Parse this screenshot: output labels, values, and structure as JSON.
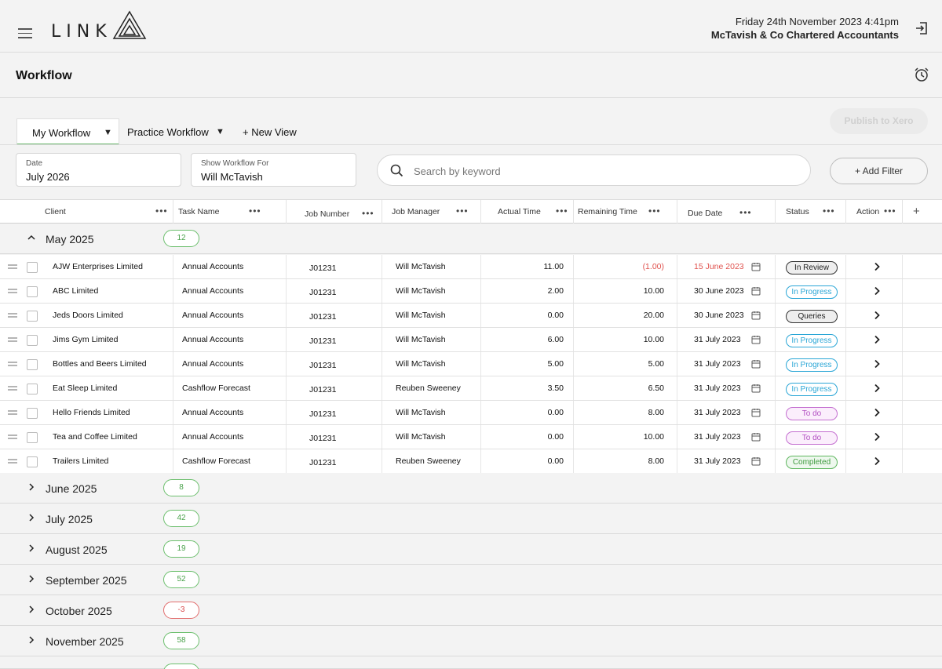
{
  "header": {
    "logo_text": "LINK",
    "date_time": "Friday 24th November 2023  4:41pm",
    "company": "McTavish & Co Chartered Accountants"
  },
  "page": {
    "title": "Workflow"
  },
  "view_tabs": {
    "my_workflow": "My Workflow",
    "practice_workflow": "Practice Workflow",
    "new_view": "+ New View",
    "caret": "▼"
  },
  "publish_label": "Publish to Xero",
  "filters": {
    "date_label": "Date",
    "date_value": "July 2026",
    "show_label": "Show Workflow For",
    "show_value": "Will McTavish",
    "search_placeholder": "Search by keyword",
    "add_filter_label": "+ Add Filter"
  },
  "columns": {
    "client": "Client",
    "task": "Task Name",
    "job_number": "Job Number",
    "manager": "Job Manager",
    "actual": "Actual Time",
    "remaining": "Remaining Time",
    "due": "Due Date",
    "status": "Status",
    "action": "Action",
    "menu_dots": "•••",
    "add_column": "+"
  },
  "expanded_group": {
    "label": "May 2025",
    "count": "12"
  },
  "rows": [
    {
      "client": "AJW Enterprises Limited",
      "task": "Annual Accounts",
      "job": "J01231",
      "manager": "Will McTavish",
      "actual": "11.00",
      "remaining": "(1.00)",
      "due": "15 June 2023",
      "status": "In Review"
    },
    {
      "client": "ABC Limited",
      "task": "Annual Accounts",
      "job": "J01231",
      "manager": "Will McTavish",
      "actual": "2.00",
      "remaining": "10.00",
      "due": "30 June 2023",
      "status": "In Progress"
    },
    {
      "client": "Jeds Doors Limited",
      "task": "Annual Accounts",
      "job": "J01231",
      "manager": "Will McTavish",
      "actual": "0.00",
      "remaining": "20.00",
      "due": "30 June 2023",
      "status": "Queries"
    },
    {
      "client": "Jims Gym Limited",
      "task": "Annual Accounts",
      "job": "J01231",
      "manager": "Will McTavish",
      "actual": "6.00",
      "remaining": "10.00",
      "due": "31 July 2023",
      "status": "In Progress"
    },
    {
      "client": "Bottles and Beers Limited",
      "task": "Annual Accounts",
      "job": "J01231",
      "manager": "Will McTavish",
      "actual": "5.00",
      "remaining": "5.00",
      "due": "31 July 2023",
      "status": "In Progress"
    },
    {
      "client": "Eat Sleep Limited",
      "task": "Cashflow Forecast",
      "job": "J01231",
      "manager": "Reuben Sweeney",
      "actual": "3.50",
      "remaining": "6.50",
      "due": "31 July 2023",
      "status": "In Progress"
    },
    {
      "client": "Hello Friends Limited",
      "task": "Annual Accounts",
      "job": "J01231",
      "manager": "Will McTavish",
      "actual": "0.00",
      "remaining": "8.00",
      "due": "31 July 2023",
      "status": "To do"
    },
    {
      "client": "Tea and Coffee Limited",
      "task": "Annual Accounts",
      "job": "J01231",
      "manager": "Will McTavish",
      "actual": "0.00",
      "remaining": "10.00",
      "due": "31 July 2023",
      "status": "To do"
    },
    {
      "client": "Trailers Limited",
      "task": "Cashflow Forecast",
      "job": "J01231",
      "manager": "Reuben Sweeney",
      "actual": "0.00",
      "remaining": "8.00",
      "due": "31 July 2023",
      "status": "Completed"
    }
  ],
  "collapsed_groups": [
    {
      "label": "June 2025",
      "count": "8"
    },
    {
      "label": "July 2025",
      "count": "42"
    },
    {
      "label": "August 2025",
      "count": "19"
    },
    {
      "label": "September 2025",
      "count": "52"
    },
    {
      "label": "October 2025",
      "count": "-3"
    },
    {
      "label": "November 2025",
      "count": "58"
    }
  ],
  "status_colors": {
    "In Review": {
      "border": "#333333",
      "bg": "#eeeeee",
      "text": "#222222"
    },
    "Queries": {
      "border": "#333333",
      "bg": "#eeeeee",
      "text": "#222222"
    },
    "In Progress": {
      "border": "#2aa6d6",
      "bg": "#ffffff",
      "text": "#2aa6d6"
    },
    "To do": {
      "border": "#c46fd0",
      "bg": "#fbeefc",
      "text": "#b24fc2"
    },
    "Completed": {
      "border": "#5fb65f",
      "bg": "#eef8ee",
      "text": "#3e9a3e"
    }
  },
  "accent_colors": {
    "overdue": "#e0534f",
    "positive": "#4aa24b",
    "tab_underline": "#6db86f"
  }
}
